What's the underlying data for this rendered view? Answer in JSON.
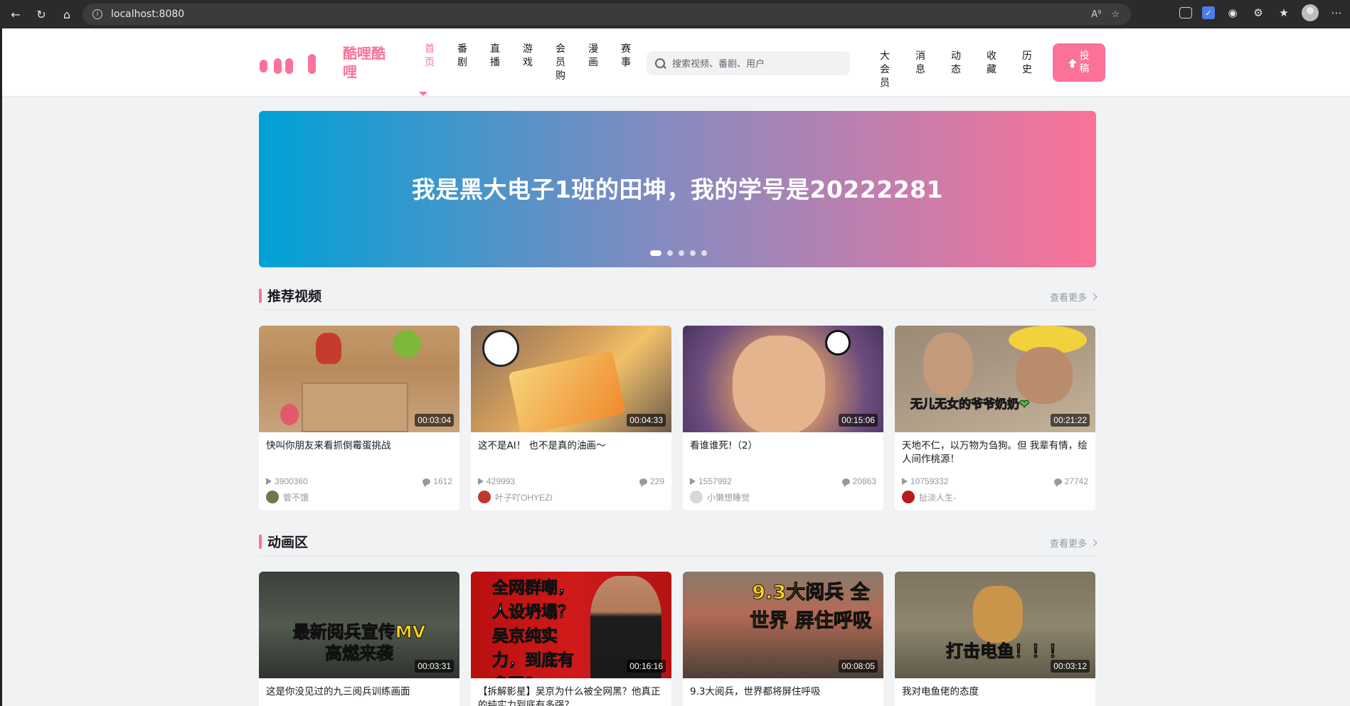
{
  "browser": {
    "url": "localhost:8080"
  },
  "header": {
    "site_name": "酷哩酷哩",
    "nav": [
      "首页",
      "番剧",
      "直播",
      "游戏",
      "会员购",
      "漫画",
      "赛事"
    ],
    "search_placeholder": "搜索视频、番剧、用户",
    "right_nav": [
      "大会员",
      "消息",
      "动态",
      "收藏",
      "历史"
    ],
    "upload_label": "投稿"
  },
  "banner": {
    "text": "我是黑大电子1班的田坤，我的学号是20222281",
    "dots": 5,
    "active_dot": 0
  },
  "sections": [
    {
      "title": "推荐视频",
      "more": "查看更多",
      "cards": [
        {
          "duration": "00:03:04",
          "title": "快叫你朋友来看抓倒霉蛋挑战",
          "views": "3900360",
          "comments": "1612",
          "author": "管不饿",
          "avatar_color": "#6b7b4a"
        },
        {
          "duration": "00:04:33",
          "title": "这不是AI！ 也不是真的油画～",
          "views": "429993",
          "comments": "229",
          "author": "叶子吖OHYEZI",
          "avatar_color": "#c0392b"
        },
        {
          "duration": "00:15:06",
          "title": "看谁谁死!（2）",
          "views": "1557992",
          "comments": "20863",
          "author": "小懒想睡觉",
          "avatar_color": "#d8d8d8"
        },
        {
          "duration": "00:21:22",
          "title": "天地不仁，以万物为刍狗。但 我辈有情，绘人间作桃源！",
          "views": "10759332",
          "comments": "27742",
          "author": "扯淡人生-",
          "avatar_color": "#b71c1c",
          "thumb_caption": "无儿无女的爷爷奶奶❤"
        }
      ]
    },
    {
      "title": "动画区",
      "more": "查看更多",
      "cards": [
        {
          "duration": "00:03:31",
          "title": "这是你没见过的九三阅兵训练画面",
          "thumb_caption": "最新阅兵宣传MV 高燃来袭"
        },
        {
          "duration": "00:16:16",
          "title": "【拆解影星】吴京为什么被全网黑？他真正的纯实力到底有多强？",
          "thumb_caption": "全网群嘲，人设坍塌？吴京纯实力，到底有多强？"
        },
        {
          "duration": "00:08:05",
          "title": "9.3大阅兵，世界都将屏住呼吸",
          "thumb_caption": "9.3大阅兵 全世界 屏住呼吸"
        },
        {
          "duration": "00:03:12",
          "title": "我对电鱼佬的态度",
          "thumb_caption": "打击电鱼！！！"
        }
      ]
    }
  ],
  "colors": {
    "brand": "#fb7299",
    "banner_start": "#00a1d6",
    "banner_end": "#fb7299"
  }
}
